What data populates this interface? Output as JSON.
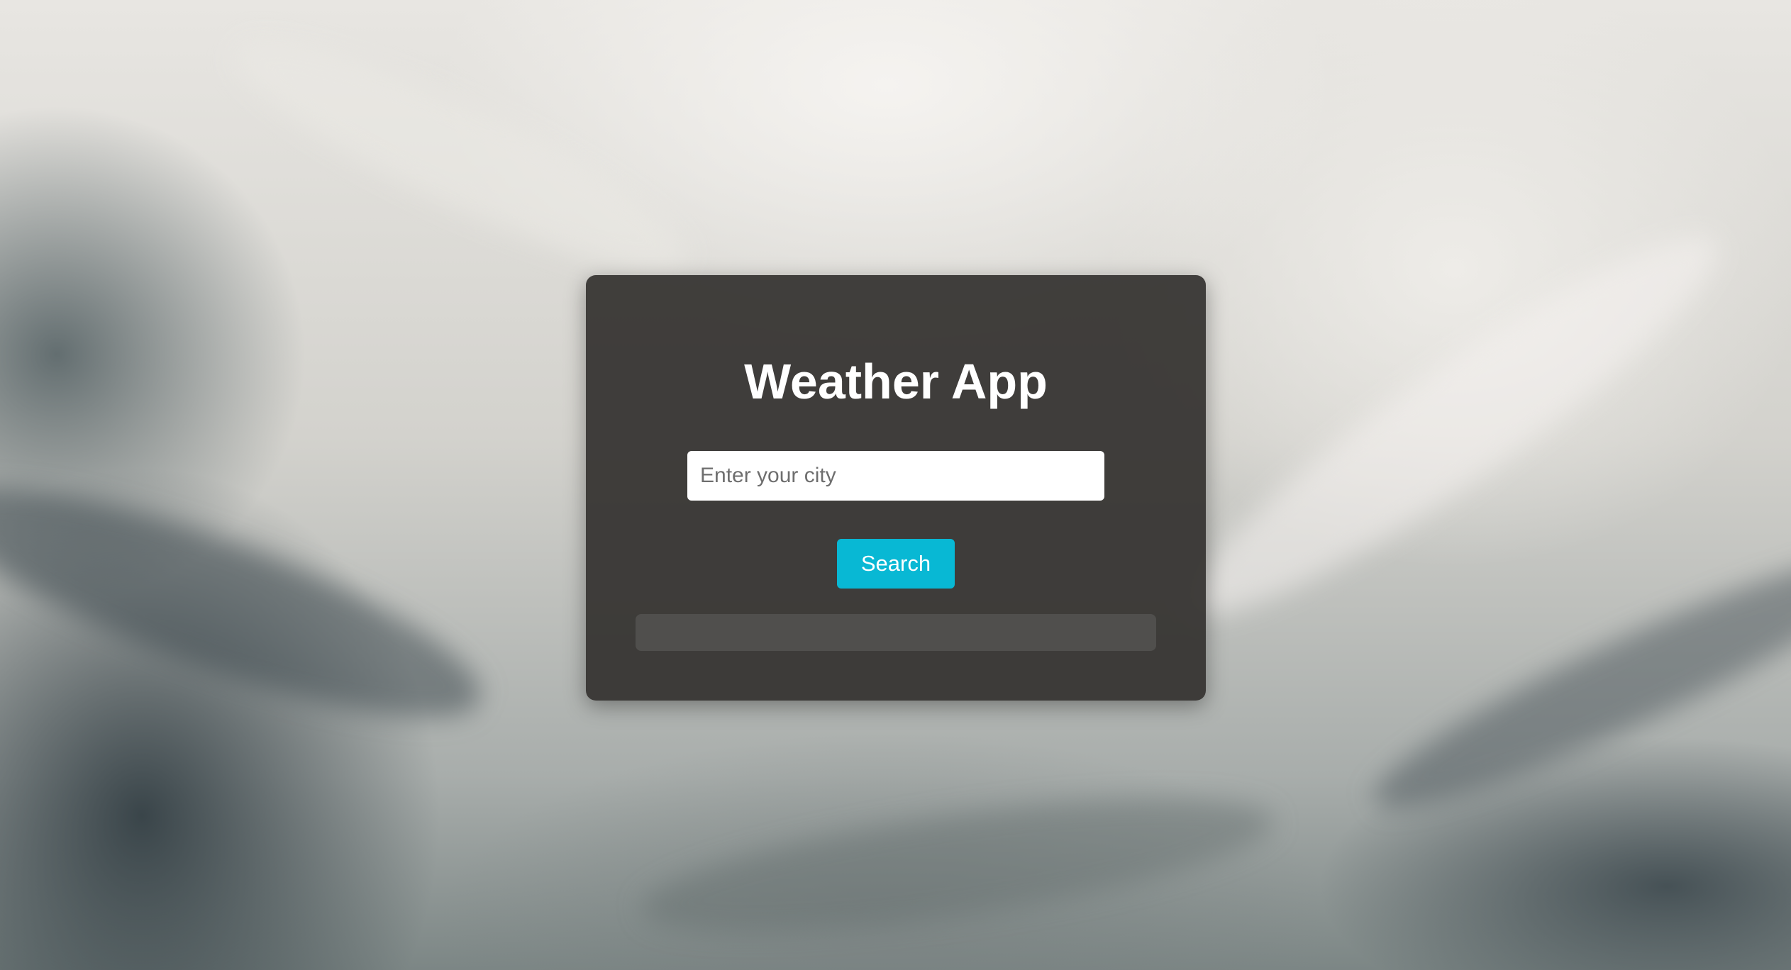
{
  "app": {
    "title": "Weather App"
  },
  "search": {
    "placeholder": "Enter your city",
    "value": "",
    "button_label": "Search"
  },
  "result": {
    "text": ""
  },
  "colors": {
    "card_background": "#34322f",
    "button_accent": "#08b8d4",
    "title_text": "#ffffff"
  }
}
